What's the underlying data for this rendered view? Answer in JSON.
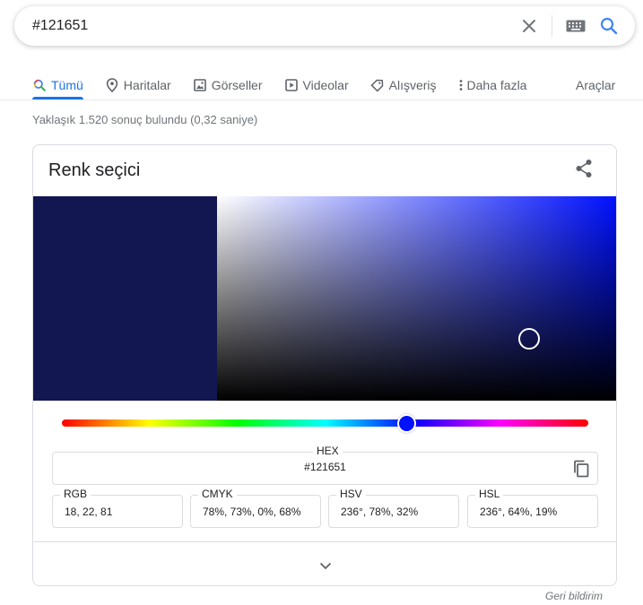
{
  "search": {
    "query": "#121651"
  },
  "tabs": [
    {
      "label": "Tümü",
      "icon": "search-icon",
      "active": true
    },
    {
      "label": "Haritalar",
      "icon": "map-pin-icon"
    },
    {
      "label": "Görseller",
      "icon": "image-icon"
    },
    {
      "label": "Videolar",
      "icon": "video-play-icon"
    },
    {
      "label": "Alışveriş",
      "icon": "tag-icon"
    },
    {
      "label": "Daha fazla",
      "icon": "more-vert-icon"
    }
  ],
  "tools_label": "Araçlar",
  "result_stats": "Yaklaşık 1.520 sonuç bulundu (0,32 saniye)",
  "card": {
    "title": "Renk seçici",
    "selected_color": "#121651",
    "hue_degrees": 236,
    "hex_label": "HEX",
    "hex_value": "#121651",
    "fields": [
      {
        "label": "RGB",
        "value": "18, 22, 81"
      },
      {
        "label": "CMYK",
        "value": "78%, 73%, 0%, 68%"
      },
      {
        "label": "HSV",
        "value": "236°, 78%, 32%"
      },
      {
        "label": "HSL",
        "value": "236°, 64%, 19%"
      }
    ]
  },
  "feedback_label": "Geri bildirim",
  "colors": {
    "accent": "#1a73e8",
    "muted_text": "#70757a",
    "tab_text": "#5f6368"
  }
}
